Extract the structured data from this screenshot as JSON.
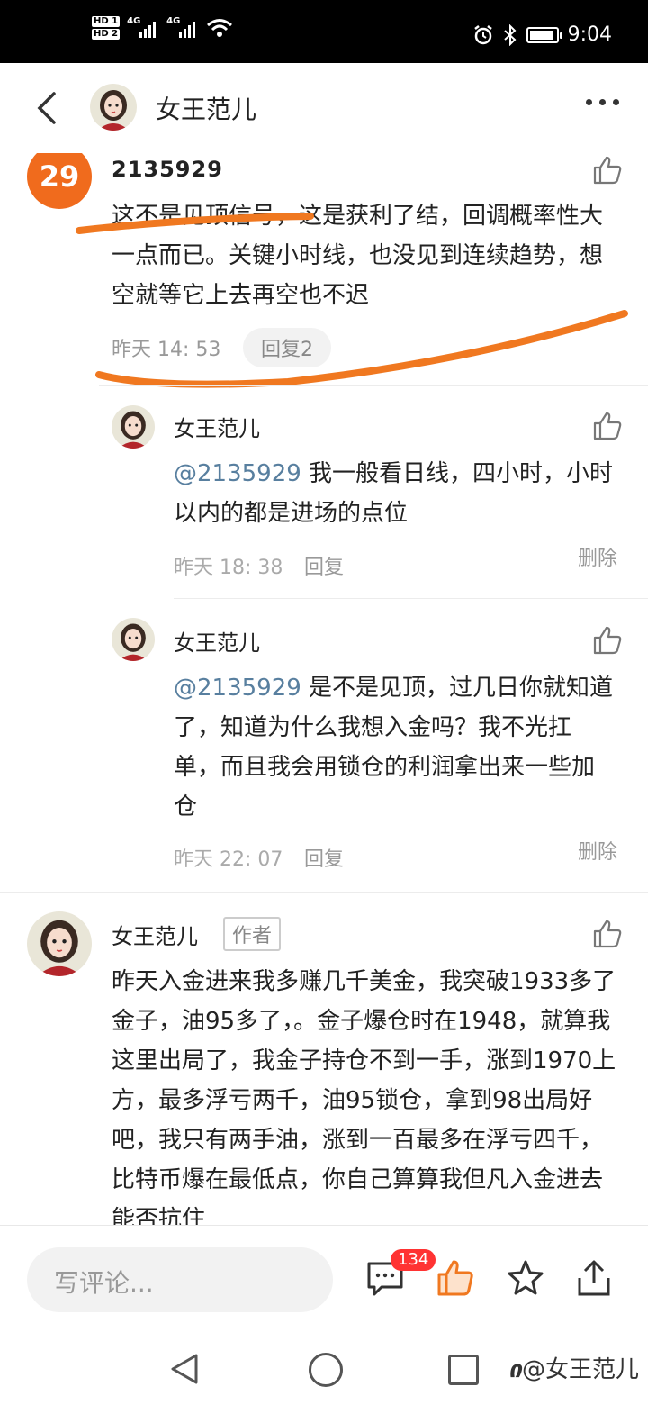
{
  "status_bar": {
    "hd1": "HD 1",
    "hd2": "HD 2",
    "net1": "4G",
    "net2": "4G",
    "time": "9:04"
  },
  "header": {
    "title": "女王范儿"
  },
  "comment": {
    "rank": "29",
    "username": "2135929",
    "text": "这不是见顶信号，这是获利了结，回调概率性大一点而已。关键小时线，也没见到连续趋势，想空就等它上去再空也不迟",
    "time": "昨天 14: 53",
    "reply_label": "回复2"
  },
  "replies": [
    {
      "username": "女王范儿",
      "mention": "@2135929",
      "text": " 我一般看日线，四小时，小时以内的都是进场的点位",
      "time": "昨天 18: 38",
      "reply_label": "回复",
      "delete_label": "删除"
    },
    {
      "username": "女王范儿",
      "mention": "@2135929",
      "text": " 是不是见顶，过几日你就知道了，知道为什么我想入金吗？我不光扛单，而且我会用锁仓的利润拿出来一些加仓",
      "time": "昨天 22: 07",
      "reply_label": "回复",
      "delete_label": "删除"
    }
  ],
  "author_comment": {
    "username": "女王范儿",
    "tag": "作者",
    "text": "昨天入金进来我多赚几千美金，我突破1933多了金子，油95多了，。金子爆仓时在1948，就算我这里出局了，我金子持仓不到一手，涨到1970上方，最多浮亏两千，油95锁仓，拿到98出局好吧，我只有两手油，涨到一百最多在浮亏四千，比特币爆在最低点，你自己算算我但凡入金进去能否抗住"
  },
  "bottom_bar": {
    "input_placeholder": "写评论...",
    "comment_count": "134"
  },
  "watermark": "@女王范儿",
  "colors": {
    "badge": "#f06b1d",
    "annotation": "#f07820",
    "mention": "#587f9f"
  }
}
